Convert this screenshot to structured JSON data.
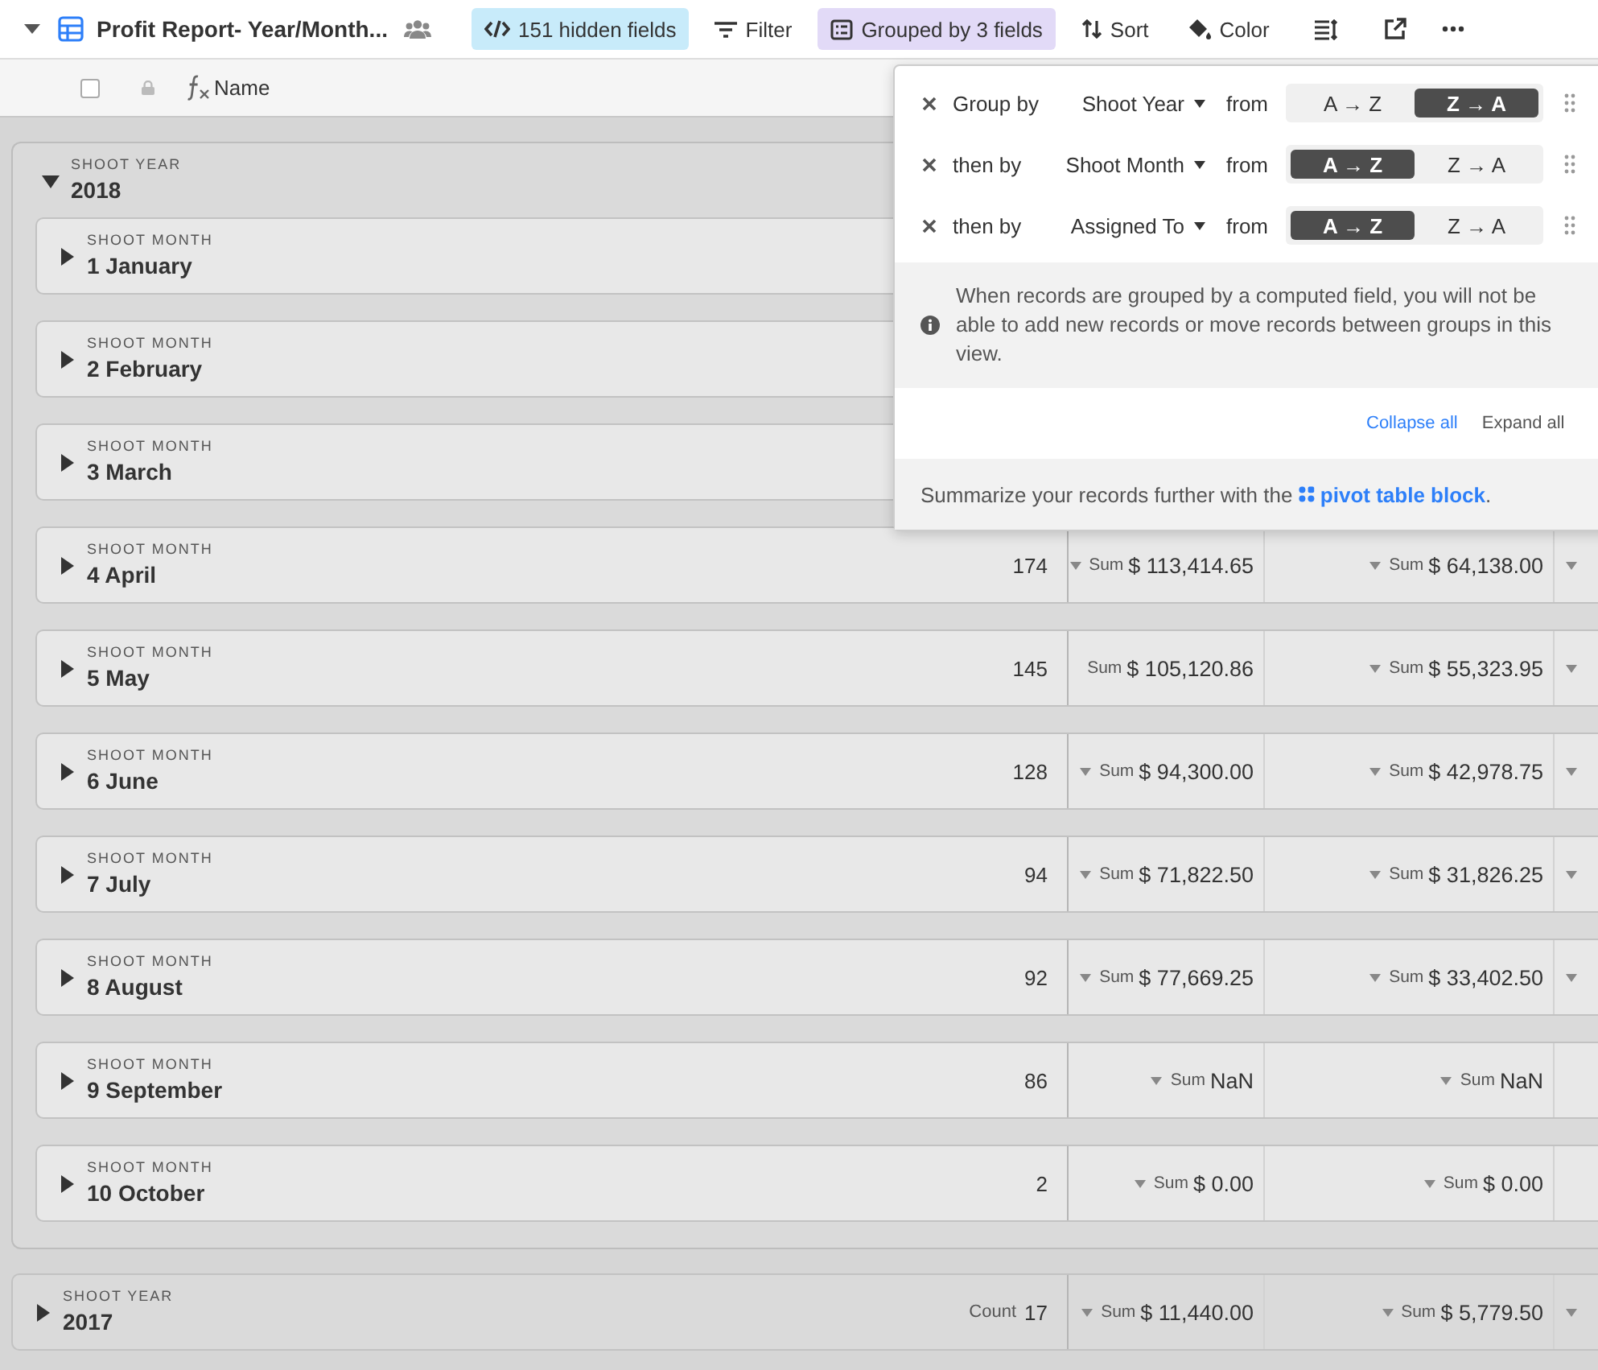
{
  "toolbar": {
    "title": "Profit Report- Year/Month...",
    "buttons": [
      {
        "kind": "hidden",
        "label": "151 hidden fields",
        "active": true
      },
      {
        "kind": "filter",
        "label": "Filter",
        "active": false
      },
      {
        "kind": "group",
        "label": "Grouped by 3 fields",
        "active": true
      },
      {
        "kind": "sort",
        "label": "Sort",
        "active": false
      },
      {
        "kind": "color",
        "label": "Color",
        "active": false
      }
    ]
  },
  "header": {
    "checked": false,
    "column_1": "Name"
  },
  "groups": [
    {
      "field": "SHOOT YEAR",
      "value": "2018",
      "expanded": true,
      "children": [
        {
          "field": "SHOOT MONTH",
          "value": "1 January",
          "expanded": false
        },
        {
          "field": "SHOOT MONTH",
          "value": "2 February",
          "expanded": false
        },
        {
          "field": "SHOOT MONTH",
          "value": "3 March",
          "expanded": false
        },
        {
          "field": "SHOOT MONTH",
          "value": "4 April",
          "expanded": false,
          "count": "174",
          "cells": [
            {
              "caret": true,
              "label": "Sum",
              "value": "$ 113,414.65"
            },
            {
              "caret": true,
              "label": "Sum",
              "value": "$ 64,138.00"
            },
            {
              "caret": true
            }
          ]
        },
        {
          "field": "SHOOT MONTH",
          "value": "5 May",
          "expanded": false,
          "count": "145",
          "cells": [
            {
              "caret": false,
              "label": "Sum",
              "value": "$ 105,120.86"
            },
            {
              "caret": true,
              "label": "Sum",
              "value": "$ 55,323.95"
            },
            {
              "caret": true
            }
          ]
        },
        {
          "field": "SHOOT MONTH",
          "value": "6 June",
          "expanded": false,
          "count": "128",
          "cells": [
            {
              "caret": true,
              "label": "Sum",
              "value": "$ 94,300.00"
            },
            {
              "caret": true,
              "label": "Sum",
              "value": "$ 42,978.75"
            },
            {
              "caret": true
            }
          ]
        },
        {
          "field": "SHOOT MONTH",
          "value": "7 July",
          "expanded": false,
          "count": "94",
          "cells": [
            {
              "caret": true,
              "label": "Sum",
              "value": "$ 71,822.50"
            },
            {
              "caret": true,
              "label": "Sum",
              "value": "$ 31,826.25"
            },
            {
              "caret": true
            }
          ]
        },
        {
          "field": "SHOOT MONTH",
          "value": "8 August",
          "expanded": false,
          "count": "92",
          "cells": [
            {
              "caret": true,
              "label": "Sum",
              "value": "$ 77,669.25"
            },
            {
              "caret": true,
              "label": "Sum",
              "value": "$ 33,402.50"
            },
            {
              "caret": true
            }
          ]
        },
        {
          "field": "SHOOT MONTH",
          "value": "9 September",
          "expanded": false,
          "count": "86",
          "cells": [
            {
              "caret": true,
              "label": "Sum",
              "value": "NaN"
            },
            {
              "caret": true,
              "label": "Sum",
              "value": "NaN"
            },
            {
              "caret": false
            }
          ]
        },
        {
          "field": "SHOOT MONTH",
          "value": "10 October",
          "expanded": false,
          "count": "2",
          "cells": [
            {
              "caret": true,
              "label": "Sum",
              "value": "$ 0.00"
            },
            {
              "caret": true,
              "label": "Sum",
              "value": "$ 0.00"
            },
            {
              "caret": false
            }
          ]
        }
      ]
    },
    {
      "field": "SHOOT YEAR",
      "value": "2017",
      "expanded": false,
      "count_label": "Count",
      "count": "17",
      "cells": [
        {
          "caret": true,
          "label": "Sum",
          "value": "$ 11,440.00"
        },
        {
          "caret": true,
          "label": "Sum",
          "value": "$ 5,779.50"
        },
        {
          "caret": true
        }
      ]
    }
  ],
  "popover": {
    "rules": [
      {
        "label": "Group by",
        "field": "Shoot Year",
        "connector": "from",
        "options": [
          {
            "label": "A → Z",
            "selected": false
          },
          {
            "label": "Z → A",
            "selected": true
          }
        ]
      },
      {
        "label": "then by",
        "field": "Shoot Month",
        "connector": "from",
        "options": [
          {
            "label": "A → Z",
            "selected": true
          },
          {
            "label": "Z → A",
            "selected": false
          }
        ]
      },
      {
        "label": "then by",
        "field": "Assigned To",
        "connector": "from",
        "options": [
          {
            "label": "A → Z",
            "selected": true
          },
          {
            "label": "Z → A",
            "selected": false
          }
        ]
      }
    ],
    "note": "When records are grouped by a computed field, you will not be able to add new records or move records between groups in this view.",
    "collapse_all": "Collapse all",
    "expand_all": "Expand all",
    "footer": {
      "text": "Summarize your records further with the",
      "link": "pivot table block",
      "end": "."
    }
  }
}
